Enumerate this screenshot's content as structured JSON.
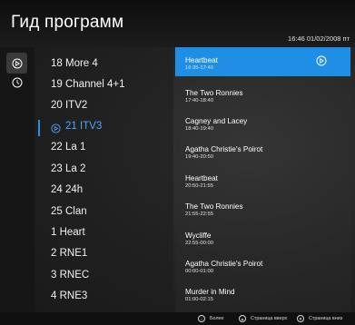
{
  "header": {
    "title": "Гид программ",
    "clock": "16:46 01/02/2008 пт"
  },
  "rail": [
    {
      "icon": "play-circle-icon",
      "active": true
    },
    {
      "icon": "clock-icon",
      "active": false
    }
  ],
  "channels": [
    {
      "label": "18 More 4"
    },
    {
      "label": "19 Channel 4+1"
    },
    {
      "label": "20 ITV2"
    },
    {
      "label": "21 ITV3",
      "selected": true,
      "icon": "play-circle-icon"
    },
    {
      "label": "22 La 1"
    },
    {
      "label": "23 La 2"
    },
    {
      "label": "24 24h"
    },
    {
      "label": "25 Clan"
    },
    {
      "label": "1 Heart"
    },
    {
      "label": "2 RNE1"
    },
    {
      "label": "3 RNEC"
    },
    {
      "label": "4 RNE3"
    }
  ],
  "programs": [
    {
      "title": "Heartbeat",
      "time": "16:35-17:40",
      "selected": true,
      "icon": "play-circle-icon"
    },
    {
      "title": "The Two Ronnies",
      "time": "17:40-18:40"
    },
    {
      "title": "Cagney and Lacey",
      "time": "18:40-19:40"
    },
    {
      "title": "Agatha Christie's Poirot",
      "time": "19:40-20:50"
    },
    {
      "title": "Heartbeat",
      "time": "20:50-21:55"
    },
    {
      "title": "The Two Ronnies",
      "time": "21:55-22:55"
    },
    {
      "title": "Wycliffe",
      "time": "22:55-00:00"
    },
    {
      "title": "Agatha Christie's Poirot",
      "time": "00:00-01:00"
    },
    {
      "title": "Murder in Mind",
      "time": "01:00-02:15"
    }
  ],
  "footer": {
    "more": {
      "label": "Более",
      "icon": "info-icon"
    },
    "page_up": {
      "label": "Страница вверх",
      "icon": "up-icon"
    },
    "page_down": {
      "label": "Страница вниз",
      "icon": "down-icon"
    }
  },
  "colors": {
    "accent": "#1f8fe6",
    "selected_channel": "#4aa8ff"
  }
}
